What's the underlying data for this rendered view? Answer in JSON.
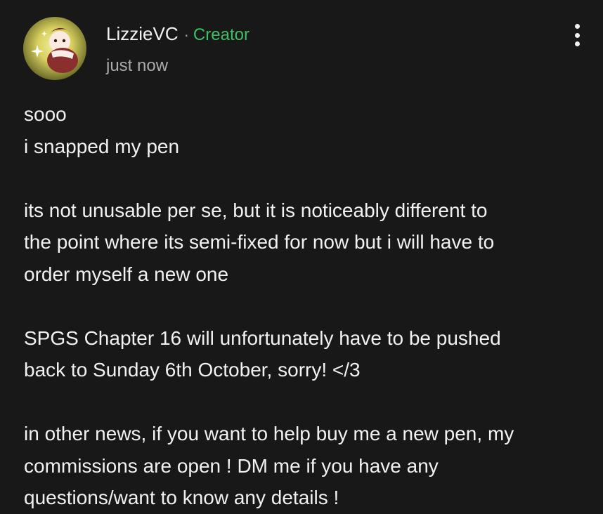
{
  "post": {
    "author": "LizzieVC",
    "separator": "·",
    "role": "Creator",
    "timestamp": "just now",
    "more_icon": "vertical-ellipsis",
    "paragraphs": [
      "sooo\ni snapped my pen",
      "its not unusable per se, but it is noticeably different to\nthe point where its semi-fixed for now but i will have to\norder myself a new one",
      "SPGS Chapter 16 will unfortunately have to be pushed\nback to Sunday 6th October, sorry! </3",
      "in other news, if you want to help buy me a new pen, my\ncommissions are open ! DM me if you have any\nquestions/want to know any details !"
    ]
  },
  "colors": {
    "background": "#181818",
    "text": "#f1f1f1",
    "secondary_text": "#aaaaaa",
    "creator_badge": "#3fbf65"
  }
}
